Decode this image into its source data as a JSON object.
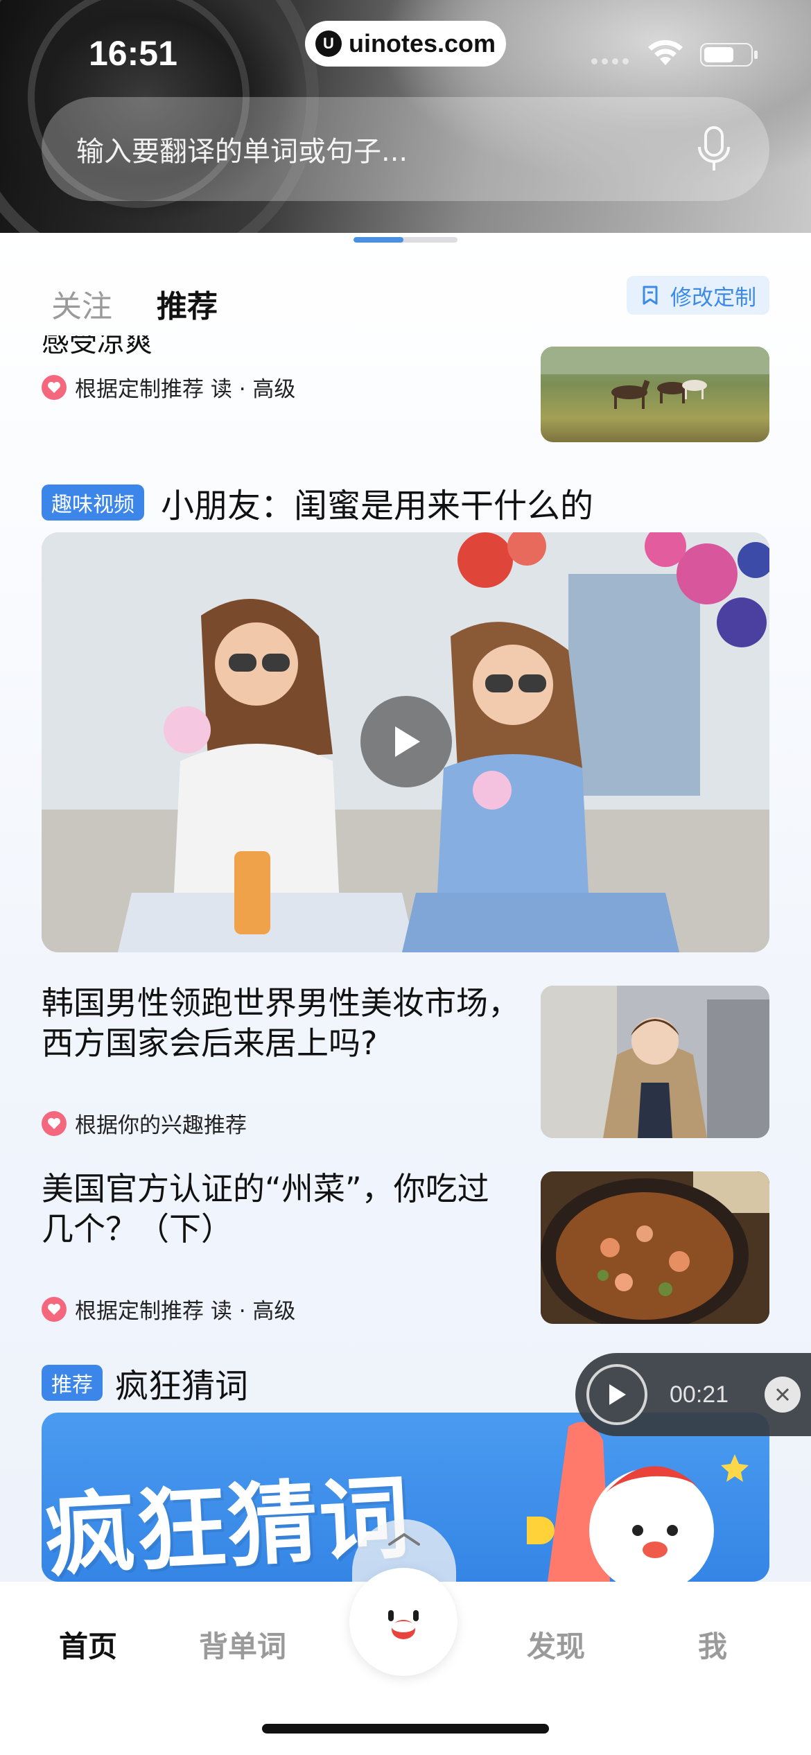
{
  "status_bar": {
    "time": "16:51",
    "watermark_logo": "U",
    "watermark_text": "uinotes.com"
  },
  "search": {
    "placeholder": "输入要翻译的单词或句子..."
  },
  "tabs": [
    {
      "label": "关注",
      "active": false
    },
    {
      "label": "推荐",
      "active": true
    }
  ],
  "customize_button": {
    "label": "修改定制"
  },
  "feed": {
    "partial_card": {
      "title": "感受凉爽",
      "meta": "根据定制推荐 读 · 高级"
    },
    "video_card": {
      "tag": "趣味视频",
      "title": "小朋友：闺蜜是用来干什么的"
    },
    "article_1": {
      "title": "韩国男性领跑世界男性美妆市场，西方国家会后来居上吗?",
      "meta": "根据你的兴趣推荐"
    },
    "article_2": {
      "title": "美国官方认证的“州菜”，你吃过几个？（下）",
      "meta": "根据定制推荐 读 · 高级"
    },
    "promo_card": {
      "tag": "推荐",
      "title": "疯狂猜词",
      "banner_text": "疯狂猜词"
    }
  },
  "audio_player": {
    "time": "00:21"
  },
  "bottom_nav": [
    {
      "label": "首页",
      "active": true
    },
    {
      "label": "背单词",
      "active": false
    },
    {
      "label": "发现",
      "active": false
    },
    {
      "label": "我",
      "active": false
    }
  ],
  "colors": {
    "accent_blue": "#3b86e8",
    "heart_pink": "#f4677d",
    "audio_bar": "#373c42"
  }
}
